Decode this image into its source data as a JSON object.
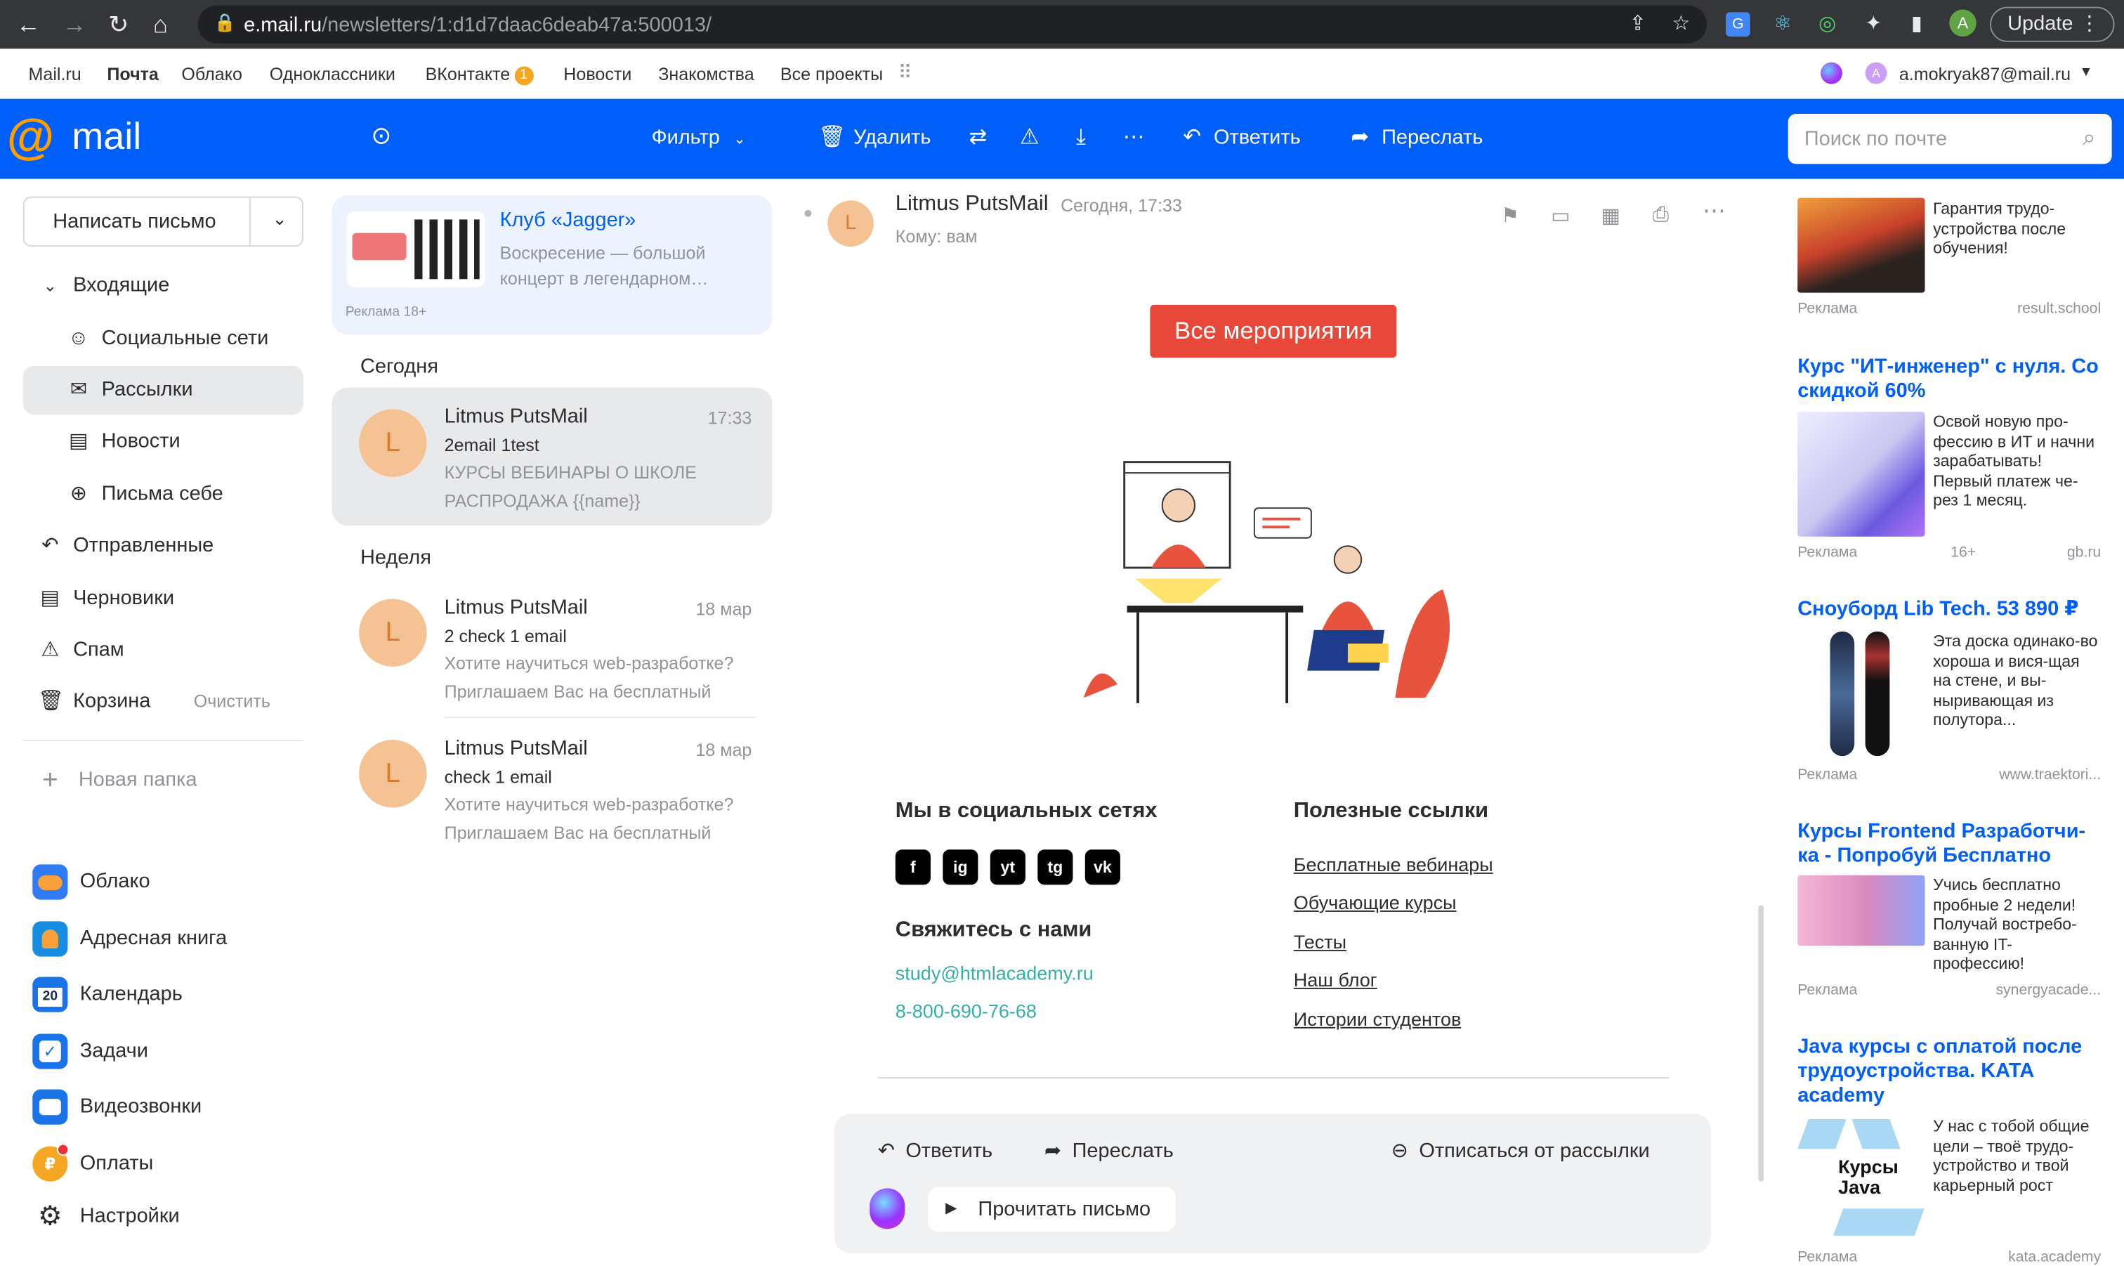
{
  "browser": {
    "url_host": "e.mail.ru",
    "url_path": "/newsletters/1:d1d7daac6deab47a:500013/",
    "update_label": "Update",
    "profile_letter": "A"
  },
  "portal": {
    "links": [
      "Mail.ru",
      "Почта",
      "Облако",
      "Одноклассники",
      "ВКонтакте",
      "Новости",
      "Знакомства",
      "Все проекты"
    ],
    "vk_badge": "1",
    "account": "a.mokryak87@mail.ru",
    "account_letter": "A"
  },
  "toolbar": {
    "logo": "mail",
    "filter": "Фильтр",
    "delete": "Удалить",
    "reply": "Ответить",
    "forward": "Переслать",
    "search_placeholder": "Поиск по почте"
  },
  "sidebar": {
    "compose": "Написать письмо",
    "inbox": "Входящие",
    "folders": [
      {
        "label": "Социальные сети",
        "icon": "people-icon"
      },
      {
        "label": "Рассылки",
        "icon": "newsletter-icon"
      },
      {
        "label": "Новости",
        "icon": "news-icon"
      },
      {
        "label": "Письма себе",
        "icon": "inbox-self-icon"
      }
    ],
    "sent": "Отправленные",
    "drafts": "Черновики",
    "spam": "Спам",
    "trash": "Корзина",
    "trash_clear": "Очистить",
    "new_folder": "Новая папка",
    "apps": [
      {
        "label": "Облако",
        "icon": "cloud-icon",
        "color": "#f57c2a",
        "glyph": "☁"
      },
      {
        "label": "Адресная книга",
        "icon": "contacts-icon",
        "color": "#168de2",
        "glyph": "👤"
      },
      {
        "label": "Календарь",
        "icon": "calendar-icon",
        "color": "#1a73e8",
        "glyph": "20"
      },
      {
        "label": "Задачи",
        "icon": "tasks-icon",
        "color": "#1a73e8",
        "glyph": "✓"
      },
      {
        "label": "Видеозвонки",
        "icon": "video-icon",
        "color": "#1a73e8",
        "glyph": "▶"
      },
      {
        "label": "Оплаты",
        "icon": "payments-icon",
        "color": "#f5a623",
        "glyph": "₽"
      },
      {
        "label": "Настройки",
        "icon": "gear-icon",
        "color": "#ffffff",
        "glyph": "⚙"
      }
    ]
  },
  "list": {
    "ad": {
      "title": "Клуб «Jagger»",
      "text": "Воскресение — большой концерт в легендарном…",
      "label": "Реклама 18+"
    },
    "section_today": "Сегодня",
    "section_week": "Неделя",
    "messages": [
      {
        "from": "Litmus PutsMail",
        "date": "17:33",
        "subject": "2email 1test",
        "preview": "КУРСЫ ВЕБИНАРЫ О ШКОЛЕ РАСПРОДАЖА {{name}}",
        "avatar": "L"
      },
      {
        "from": "Litmus PutsMail",
        "date": "18 мар",
        "subject": "2 check 1 email",
        "preview": "Хотите научиться web-разработке? Приглашаем Вас на бесплатный",
        "avatar": "L"
      },
      {
        "from": "Litmus PutsMail",
        "date": "18 мар",
        "subject": "check 1 email",
        "preview": "Хотите научиться web-разработке? Приглашаем Вас на бесплатный",
        "avatar": "L"
      }
    ]
  },
  "reader": {
    "from": "Litmus PutsMail",
    "time": "Сегодня, 17:33",
    "to": "Кому: вам",
    "avatar": "L",
    "cta": "Все мероприятия",
    "social_heading": "Мы в социальных сетях",
    "social": [
      "f",
      "ig",
      "yt",
      "tg",
      "vk"
    ],
    "contact_heading": "Свяжитесь с нами",
    "email": "study@htmlacademy.ru",
    "phone": "8-800-690-76-68",
    "links_heading": "Полезные ссылки",
    "links": [
      "Бесплатные вебинары",
      "Обучающие курсы",
      "Тесты",
      "Наш блог",
      "Истории студентов"
    ],
    "bottom": {
      "reply": "Ответить",
      "forward": "Переслать",
      "unsubscribe": "Отписаться от рассылки",
      "read": "Прочитать письмо"
    }
  },
  "ads": [
    {
      "title": "",
      "text": "Гарантия трудо-устройства после обучения!",
      "label": "Реклама",
      "age": "",
      "source": "result.school"
    },
    {
      "title": "Курс \"ИТ-инженер\" с нуля. Со скидкой 60%",
      "text": "Освой новую про-фессию в ИТ и начни зарабатывать! Первый платеж че-рез 1 месяц.",
      "label": "Реклама",
      "age": "16+",
      "source": "gb.ru"
    },
    {
      "title": "Сноуборд Lib Tech. 53 890 ₽",
      "text": "Эта доска одинако-во хороша и вися-щая на стене, и вы-ныривающая из полутора...",
      "label": "Реклама",
      "age": "",
      "source": "www.traektori..."
    },
    {
      "title": "Курсы Frontend Разработчи-ка - Попробуй Бесплатно",
      "text": "Учись бесплатно пробные 2 недели! Получай востребо-ванную IT-профессию!",
      "label": "Реклама",
      "age": "",
      "source": "synergyacade..."
    },
    {
      "title": "Java курсы с оплатой после трудоустройства. KATA academy",
      "text": "У нас с тобой общие цели – твоё трудо-устройство и твой карьерный рост",
      "label": "Реклама",
      "age": "",
      "source": "kata.academy"
    }
  ],
  "ad_image_text": {
    "java": "Курсы Java"
  }
}
